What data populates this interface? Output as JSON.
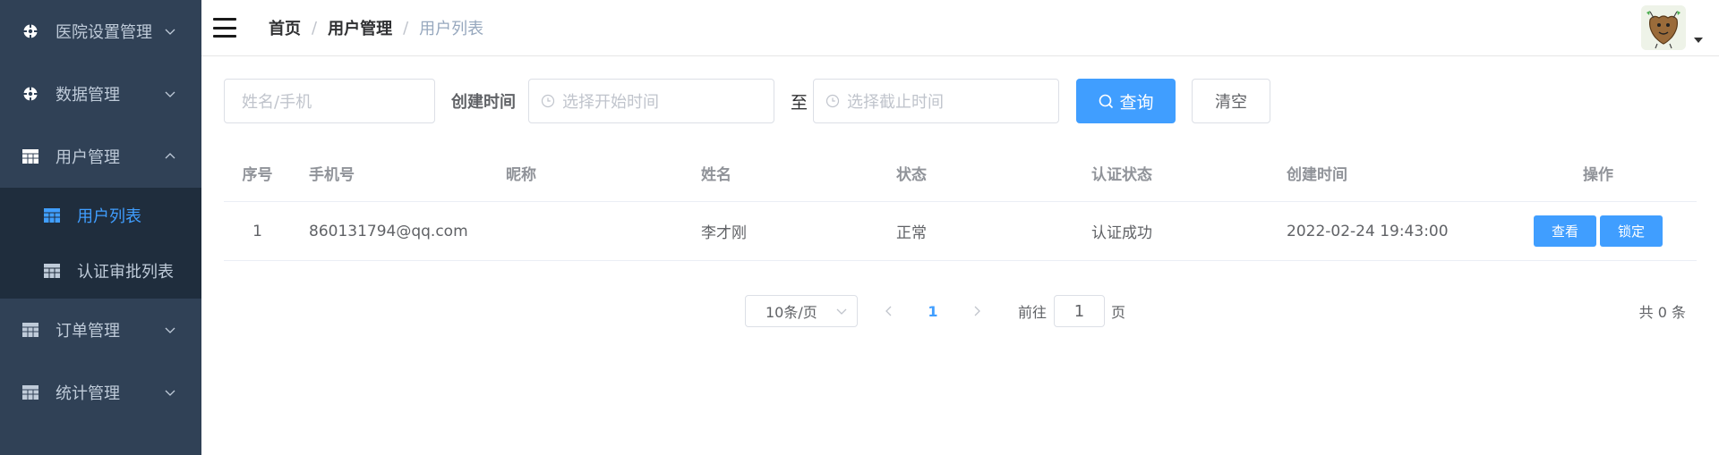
{
  "sidebar": {
    "items": [
      {
        "label": "医院设置管理",
        "icon": "target-icon",
        "expanded": false
      },
      {
        "label": "数据管理",
        "icon": "target-icon",
        "expanded": false
      },
      {
        "label": "用户管理",
        "icon": "table-icon",
        "expanded": true,
        "children": [
          {
            "label": "用户列表",
            "icon": "table-icon",
            "active": true
          },
          {
            "label": "认证审批列表",
            "icon": "table-icon",
            "active": false
          }
        ]
      },
      {
        "label": "订单管理",
        "icon": "table-icon",
        "expanded": false
      },
      {
        "label": "统计管理",
        "icon": "table-icon",
        "expanded": false
      }
    ]
  },
  "navbar": {
    "breadcrumb": [
      "首页",
      "用户管理",
      "用户列表"
    ],
    "separator": "/"
  },
  "filter": {
    "name_placeholder": "姓名/手机",
    "created_label": "创建时间",
    "start_placeholder": "选择开始时间",
    "to_label": "至",
    "end_placeholder": "选择截止时间",
    "query_label": "查询",
    "clear_label": "清空"
  },
  "table": {
    "headers": [
      "序号",
      "手机号",
      "昵称",
      "姓名",
      "状态",
      "认证状态",
      "创建时间",
      "操作"
    ],
    "rows": [
      {
        "index": "1",
        "phone": "860131794@qq.com",
        "nickname": "",
        "name": "李才刚",
        "status": "正常",
        "auth_status": "认证成功",
        "created": "2022-02-24 19:43:00",
        "view_label": "查看",
        "lock_label": "锁定"
      }
    ]
  },
  "pagination": {
    "page_size": "10条/页",
    "current_page": "1",
    "goto_label": "前往",
    "goto_value": "1",
    "page_suffix": "页",
    "total": "共 0 条"
  },
  "colors": {
    "sidebar_bg": "#304156",
    "submenu_bg": "#1f2d3d",
    "accent": "#409eff"
  }
}
